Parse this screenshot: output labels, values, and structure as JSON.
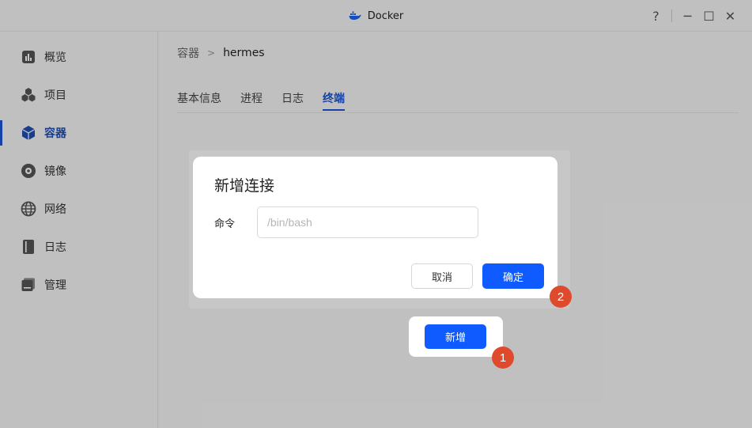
{
  "window": {
    "title": "Docker",
    "controls": {
      "help": "?",
      "minimize": "─",
      "maximize": "☐",
      "close": "✕"
    }
  },
  "sidebar": {
    "items": [
      {
        "label": "概览",
        "icon": "overview-icon"
      },
      {
        "label": "项目",
        "icon": "project-icon"
      },
      {
        "label": "容器",
        "icon": "container-icon",
        "active": true
      },
      {
        "label": "镜像",
        "icon": "image-icon"
      },
      {
        "label": "网络",
        "icon": "network-icon"
      },
      {
        "label": "日志",
        "icon": "log-icon"
      },
      {
        "label": "管理",
        "icon": "management-icon"
      }
    ]
  },
  "main": {
    "breadcrumb": {
      "parent": "容器",
      "separator": ">",
      "current": "hermes"
    },
    "tabs": [
      {
        "label": "基本信息"
      },
      {
        "label": "进程"
      },
      {
        "label": "日志"
      },
      {
        "label": "终端",
        "active": true
      }
    ]
  },
  "dialog": {
    "title": "新增连接",
    "command_label": "命令",
    "command_placeholder": "/bin/bash",
    "command_value": "",
    "cancel_label": "取消",
    "ok_label": "确定"
  },
  "add_button": {
    "label": "新增"
  },
  "steps": {
    "one": "1",
    "two": "2"
  },
  "colors": {
    "accent": "#0f5bff",
    "active_text": "#1f55d1",
    "step_marker": "#e04a2c"
  }
}
